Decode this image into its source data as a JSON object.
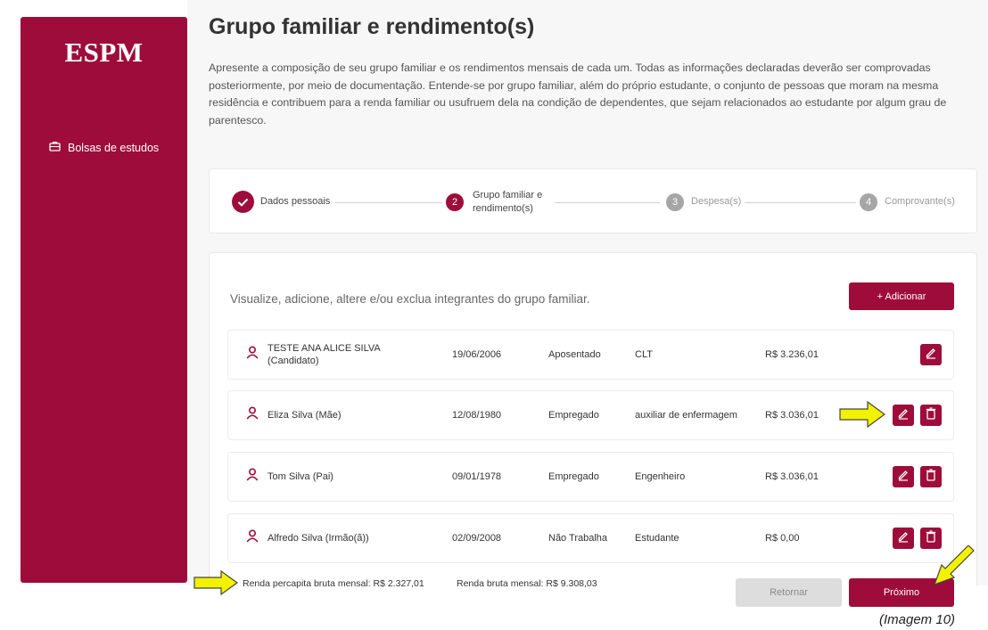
{
  "sidebar": {
    "logo": "ESPM",
    "nav_item": "Bolsas de estudos"
  },
  "page": {
    "title": "Grupo familiar e rendimento(s)",
    "intro": "Apresente a composição de seu grupo familiar e os rendimentos mensais de cada um. Todas as informações declaradas deverão ser comprovadas posteriormente, por meio de documentação. Entende-se por grupo familiar, além do próprio estudante, o conjunto de pessoas que moram na mesma residência e contribuem para a renda familiar ou usufruem dela na condição de dependentes, que sejam relacionados ao estudante por algum grau de parentesco."
  },
  "stepper": {
    "steps": [
      {
        "number": "",
        "label_line1": "Dados pessoais",
        "label_line2": "",
        "state": "done"
      },
      {
        "number": "2",
        "label_line1": "Grupo familiar e",
        "label_line2": "rendimento(s)",
        "state": "active"
      },
      {
        "number": "3",
        "label_line1": "Despesa(s)",
        "label_line2": "",
        "state": "inactive"
      },
      {
        "number": "4",
        "label_line1": "Comprovante(s)",
        "label_line2": "",
        "state": "inactive"
      }
    ]
  },
  "members_section": {
    "heading": "Visualize, adicione, altere e/ou exclua integrantes do grupo familiar.",
    "add_button": "+ Adicionar",
    "rows": [
      {
        "name": "TESTE ANA ALICE SILVA",
        "name_line2": "(Candidato)",
        "birth": "19/06/2006",
        "status": "Aposentado",
        "occupation": "CLT",
        "income": "R$ 3.236,01"
      },
      {
        "name": "Eliza Silva (Mãe)",
        "name_line2": "",
        "birth": "12/08/1980",
        "status": "Empregado",
        "occupation": "auxiliar de enfermagem",
        "income": "R$ 3.036,01"
      },
      {
        "name": "Tom Silva (Pai)",
        "name_line2": "",
        "birth": "09/01/1978",
        "status": "Empregado",
        "occupation": "Engenheiro",
        "income": "R$ 3.036,01"
      },
      {
        "name": "Alfredo Silva (Irmão(ã))",
        "name_line2": "",
        "birth": "02/09/2008",
        "status": "Não Trabalha",
        "occupation": "Estudante",
        "income": "R$ 0,00"
      }
    ]
  },
  "footer": {
    "per_capita": "Renda percapita bruta mensal: R$ 2.327,01",
    "gross": "Renda bruta mensal: R$ 9.308,03",
    "back_button": "Retornar",
    "next_button": "Próximo"
  },
  "caption": "(Imagem 10)",
  "colors": {
    "brand": "#9e0c3c",
    "annotation_arrow": "#f2f200"
  }
}
